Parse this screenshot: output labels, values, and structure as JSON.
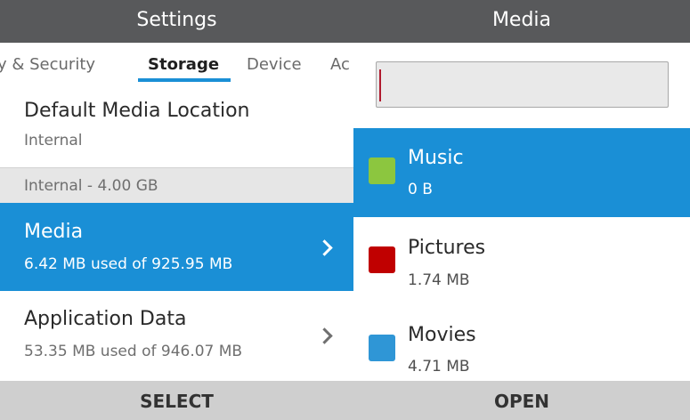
{
  "left": {
    "title": "Settings",
    "tabs": [
      {
        "label": "y & Security",
        "active": false
      },
      {
        "label": "Storage",
        "active": true
      },
      {
        "label": "Device",
        "active": false
      },
      {
        "label": "Ac",
        "active": false
      }
    ],
    "default_media": {
      "title": "Default Media Location",
      "value": "Internal"
    },
    "section_header": "Internal - 4.00 GB",
    "items": [
      {
        "title": "Media",
        "detail": "6.42 MB used of 925.95 MB",
        "selected": true
      },
      {
        "title": "Application Data",
        "detail": "53.35 MB used of 946.07 MB",
        "selected": false
      }
    ],
    "softkey": "SELECT"
  },
  "right": {
    "title": "Media",
    "search": {
      "value": "",
      "placeholder": ""
    },
    "items": [
      {
        "label": "Music",
        "size": "0 B",
        "color": "#8cc63f",
        "selected": true
      },
      {
        "label": "Pictures",
        "size": "1.74 MB",
        "color": "#c00000",
        "selected": false
      },
      {
        "label": "Movies",
        "size": "4.71 MB",
        "color": "#2f96d6",
        "selected": false
      }
    ],
    "softkey": "OPEN"
  },
  "colors": {
    "accent": "#1a8fd6",
    "titlebar": "#58595b",
    "softkey_bar": "#cfcfcf",
    "section_header": "#e6e6e6"
  }
}
